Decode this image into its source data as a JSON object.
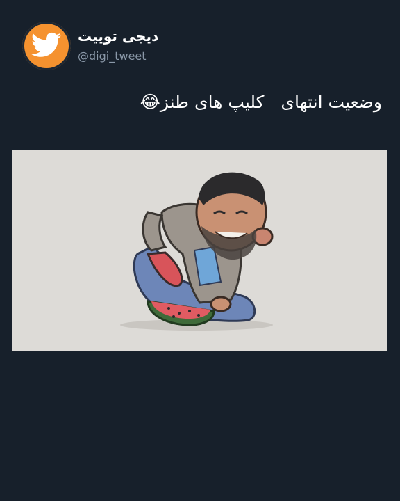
{
  "account": {
    "name": "دیجی توییت",
    "handle": "@digi_tweet",
    "avatar_icon": "bird-logo-icon",
    "avatar_color": "#f5922f"
  },
  "tweet": {
    "text": "وضعیت انتهای   کلیپ های طنز😂"
  },
  "media": {
    "description_icon": "cartoon-man-eating-watermelon-illustration"
  },
  "colors": {
    "background": "#17202b",
    "media_background": "#dddbd7",
    "handle": "#8a98a8"
  }
}
